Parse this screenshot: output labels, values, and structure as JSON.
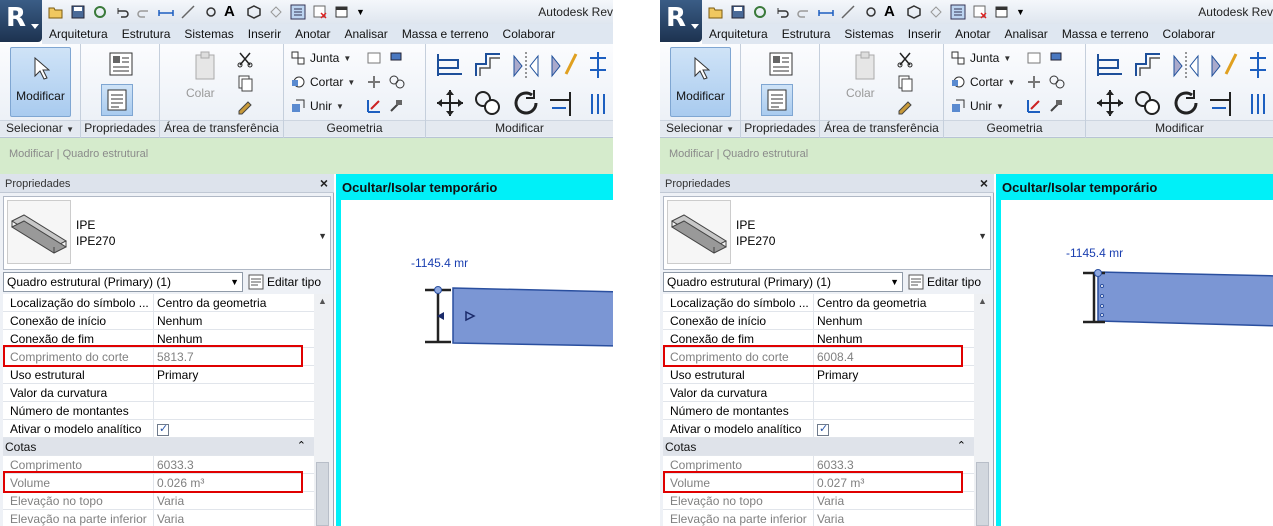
{
  "app": {
    "title": "Autodesk Rev",
    "logo_letter": "R",
    "text_icon": "A"
  },
  "ribbon": {
    "tabs": [
      "Arquitetura",
      "Estrutura",
      "Sistemas",
      "Inserir",
      "Anotar",
      "Analisar",
      "Massa e terreno",
      "Colaborar"
    ],
    "modify_button": "Modificar",
    "paste_button": "Colar",
    "join_label": "Junta",
    "cut_label": "Cortar",
    "unite_label": "Unir",
    "groups": {
      "select": "Selecionar",
      "properties": "Propriedades",
      "clipboard": "Área de transferência",
      "geometry": "Geometria",
      "modify": "Modificar"
    }
  },
  "context_bar": "Modificar | Quadro estrutural",
  "properties": {
    "title": "Propriedades",
    "type_family": "IPE",
    "type_name": "IPE270",
    "filter": "Quadro estrutural (Primary) (1)",
    "edit_type": "Editar tipo",
    "rows": [
      {
        "key": "Localização do símbolo ...",
        "value": "Centro da geometria"
      },
      {
        "key": "Conexão de início",
        "value": "Nenhum"
      },
      {
        "key": "Conexão de fim",
        "value": "Nenhum"
      },
      {
        "key": "Comprimento do corte",
        "value": "5813.7"
      },
      {
        "key": "Uso estrutural",
        "value": "Primary"
      },
      {
        "key": "Valor da curvatura",
        "value": ""
      },
      {
        "key": "Número de montantes",
        "value": ""
      },
      {
        "key": "Ativar o modelo analítico",
        "value": ""
      },
      {
        "key": "Cotas",
        "value": ""
      },
      {
        "key": "Comprimento",
        "value": "6033.3"
      },
      {
        "key": "Volume",
        "value": "0.026 m³"
      },
      {
        "key": "Elevação no topo",
        "value": "Varia"
      },
      {
        "key": "Elevação na parte inferior",
        "value": "Varia"
      }
    ],
    "right_cut_length": "6008.4",
    "right_volume": "0.027 m³"
  },
  "view": {
    "title": "Ocultar/Isolar temporário",
    "dimension_left": "-1145.4 mr",
    "dimension_right": "-1145.4 mr"
  },
  "colors": {
    "highlight": "#e00000",
    "context_bar": "#d5ebcc",
    "view_border": "#00f0f8",
    "beam_fill": "#7b96d4"
  }
}
